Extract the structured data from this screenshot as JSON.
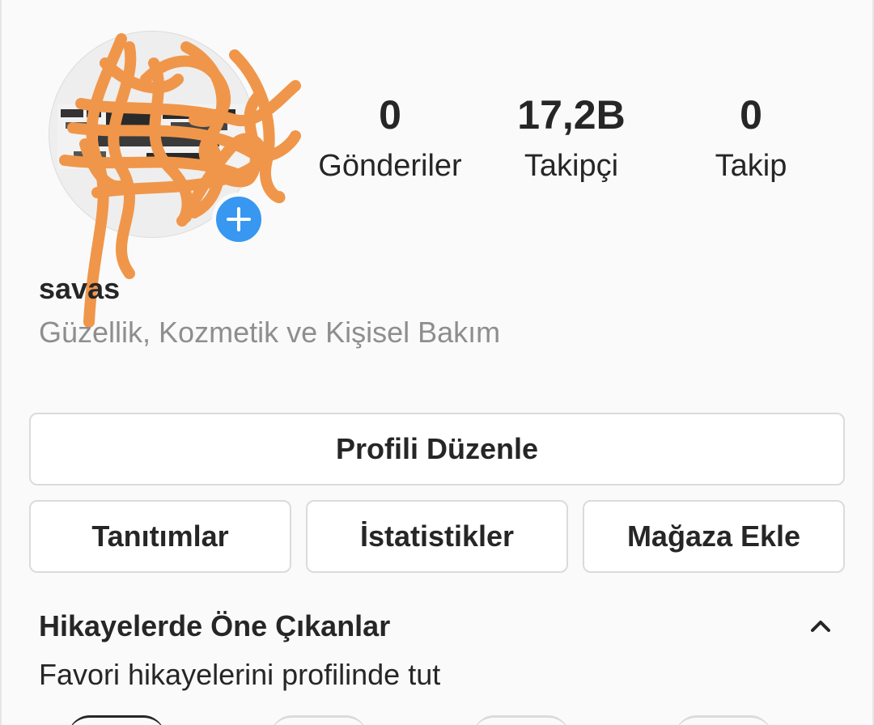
{
  "profile": {
    "username": "savas",
    "category": "Güzellik, Kozmetik ve Kişisel Bakım",
    "avatar_icon": "profile-photo",
    "add_story_icon": "plus-icon"
  },
  "stats": {
    "posts": {
      "value": "0",
      "label": "Gönderiler"
    },
    "followers": {
      "value": "17,2B",
      "label": "Takipçi"
    },
    "following": {
      "value": "0",
      "label": "Takip"
    }
  },
  "actions": {
    "edit_profile": "Profili Düzenle",
    "promotions": "Tanıtımlar",
    "insights": "İstatistikler",
    "add_shop": "Mağaza Ekle"
  },
  "highlights": {
    "title": "Hikayelerde Öne Çıkanlar",
    "subtitle": "Favori hikayelerini profilinde tut",
    "toggle_icon": "chevron-up-icon"
  },
  "colors": {
    "accent": "#3897f0",
    "scribble": "#f0964a",
    "muted_text": "#8e8e8e",
    "border": "#dbdbdb"
  }
}
